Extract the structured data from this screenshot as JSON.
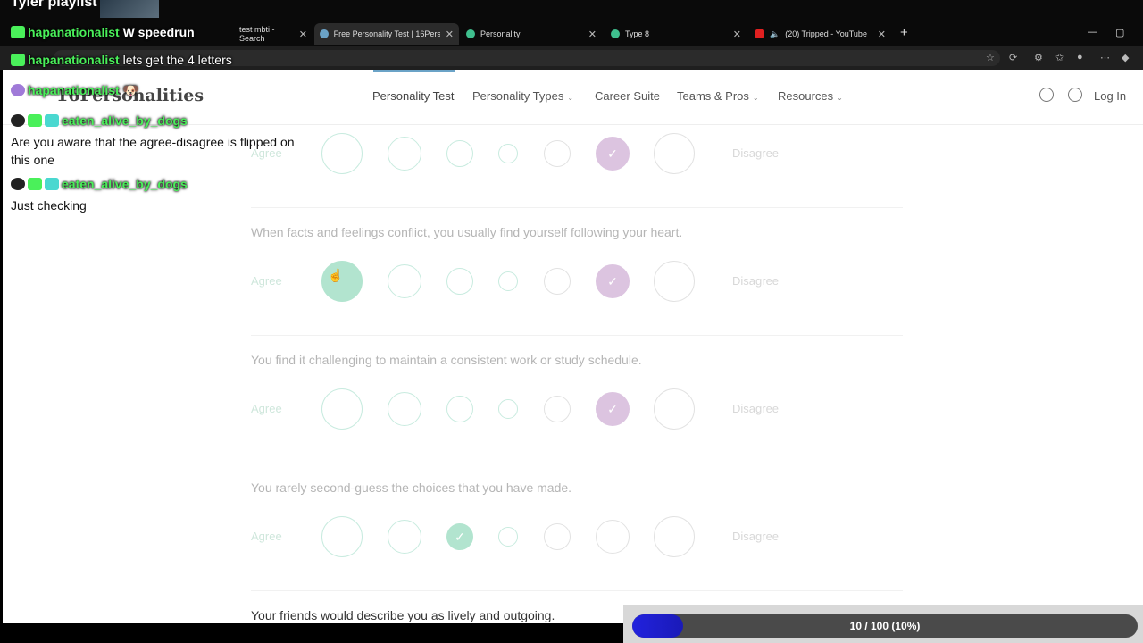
{
  "stream": {
    "title": "Tyler playlist"
  },
  "tabs": [
    {
      "label": "test mbti - Search",
      "active": false
    },
    {
      "label": "Free Personality Test | 16Personalit",
      "active": true
    },
    {
      "label": "Personality",
      "active": false
    },
    {
      "label": "Type 8",
      "active": false
    },
    {
      "label": "(20) Tripped - YouTube",
      "active": false
    }
  ],
  "nav": {
    "logo": "16Personalities",
    "items": [
      "Personality Test",
      "Personality Types",
      "Career Suite",
      "Teams & Pros",
      "Resources"
    ],
    "login": "Log In"
  },
  "questions": [
    {
      "text": "",
      "selected": 5,
      "color": "purple"
    },
    {
      "text": "When facts and feelings conflict, you usually find yourself following your heart.",
      "selected": 5,
      "color": "purple"
    },
    {
      "text": "You find it challenging to maintain a consistent work or study schedule.",
      "selected": 5,
      "color": "purple"
    },
    {
      "text": "You rarely second-guess the choices that you have made.",
      "selected": 2,
      "color": "green"
    },
    {
      "text": "Your friends would describe you as lively and outgoing.",
      "selected": -1,
      "color": "none"
    }
  ],
  "labels": {
    "agree": "Agree",
    "disagree": "Disagree"
  },
  "chat": [
    {
      "user": "hapanationalist",
      "message": "W speedrun"
    },
    {
      "user": "hapanationalist",
      "message": "lets get the 4 letters"
    },
    {
      "user": "hapanationalist",
      "message": ""
    },
    {
      "user": "eaten_alive_by_dogs",
      "message": "Are you aware that the agree-disagree is flipped on this one"
    },
    {
      "user": "eaten_alive_by_dogs",
      "message": "Just checking"
    }
  ],
  "progress": {
    "value": 10,
    "total": 100,
    "fraction": 0.1,
    "text": "10 / 100 (10%)"
  },
  "colors": {
    "green": "#b2e4cf",
    "purple": "#dcc4e0",
    "progress": "#2222dd"
  }
}
